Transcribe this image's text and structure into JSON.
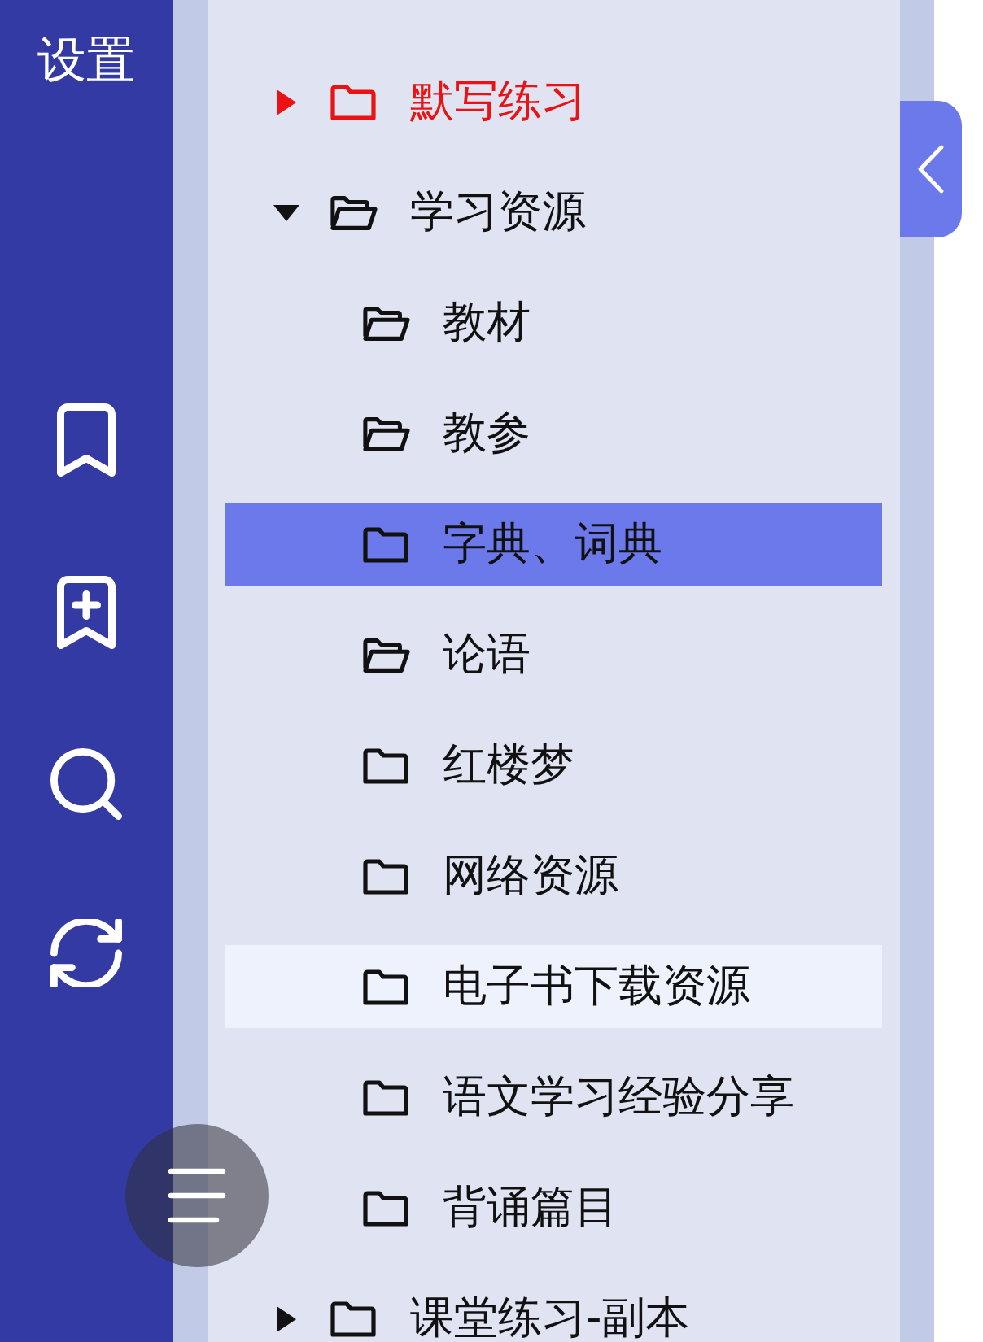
{
  "sidebar": {
    "title": "设置"
  },
  "tree": [
    {
      "kind": "branch",
      "label": "默写练习",
      "expanded": false,
      "selected": false,
      "hovered": false,
      "color": "#ea1212"
    },
    {
      "kind": "branch",
      "label": "学习资源",
      "expanded": true,
      "selected": false,
      "hovered": false,
      "children": [
        {
          "kind": "leaf",
          "label": "教材",
          "open": true,
          "selected": false,
          "hovered": false
        },
        {
          "kind": "leaf",
          "label": "教参",
          "open": true,
          "selected": false,
          "hovered": false
        },
        {
          "kind": "leaf",
          "label": "字典、词典",
          "open": false,
          "selected": true,
          "hovered": false
        },
        {
          "kind": "leaf",
          "label": "论语",
          "open": true,
          "selected": false,
          "hovered": false
        },
        {
          "kind": "leaf",
          "label": "红楼梦",
          "open": false,
          "selected": false,
          "hovered": false
        },
        {
          "kind": "leaf",
          "label": "网络资源",
          "open": false,
          "selected": false,
          "hovered": false
        },
        {
          "kind": "leaf",
          "label": "电子书下载资源",
          "open": false,
          "selected": false,
          "hovered": true
        },
        {
          "kind": "leaf",
          "label": "语文学习经验分享",
          "open": false,
          "selected": false,
          "hovered": false
        },
        {
          "kind": "leaf",
          "label": "背诵篇目",
          "open": false,
          "selected": false,
          "hovered": false
        }
      ]
    },
    {
      "kind": "branch",
      "label": "课堂练习-副本",
      "expanded": false,
      "selected": false,
      "hovered": false
    }
  ]
}
